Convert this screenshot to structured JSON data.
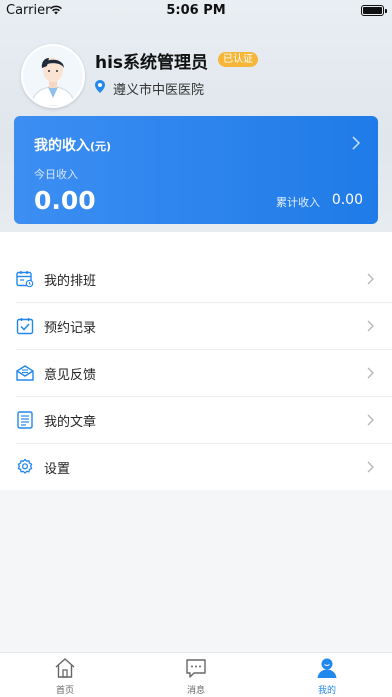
{
  "status_bar": {
    "carrier": "Carrier",
    "time": "5:06 PM"
  },
  "profile": {
    "name": "his系统管理员",
    "verified_badge": "已认证",
    "hospital": "遵义市中医医院"
  },
  "income_card": {
    "title": "我的收入",
    "unit": "(元)",
    "today_label": "今日收入",
    "today_value": "0.00",
    "total_label": "累计收入",
    "total_value": "0.00"
  },
  "menu": [
    {
      "label": "我的排班",
      "icon": "schedule-icon"
    },
    {
      "label": "预约记录",
      "icon": "appointment-icon"
    },
    {
      "label": "意见反馈",
      "icon": "feedback-icon"
    },
    {
      "label": "我的文章",
      "icon": "article-icon"
    },
    {
      "label": "设置",
      "icon": "settings-icon"
    }
  ],
  "tabbar": [
    {
      "label": "首页",
      "icon": "home-icon"
    },
    {
      "label": "消息",
      "icon": "message-icon"
    },
    {
      "label": "我的",
      "icon": "profile-icon",
      "active": true
    }
  ],
  "colors": {
    "accent": "#2388ec",
    "badge": "#f6b63a",
    "card_start": "#3c8ef2",
    "card_end": "#1f7be8"
  }
}
